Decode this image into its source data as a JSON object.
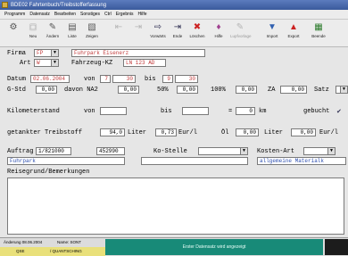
{
  "window": {
    "title": "BDE02  Fahrtenbuch/Treibstofferfassung"
  },
  "menu": [
    "Programm",
    "Datensatz",
    "Bearbeiten",
    "Sonstiges",
    "Ctrl",
    "Ergebnis",
    "Hilfe"
  ],
  "toolbar": [
    {
      "label": "",
      "icon": "record-icon",
      "disabled": false
    },
    {
      "label": "Neu",
      "icon": "new-icon",
      "disabled": false
    },
    {
      "label": "Ändern",
      "icon": "edit-icon",
      "disabled": false
    },
    {
      "label": "Liste",
      "icon": "list-icon",
      "disabled": false
    },
    {
      "label": "Zeigen",
      "icon": "show-icon",
      "disabled": false
    },
    {
      "label": "",
      "icon": "back-icon",
      "disabled": true
    },
    {
      "label": "",
      "icon": "forward-icon",
      "disabled": true
    },
    {
      "label": "Vorwärts",
      "icon": "next-icon",
      "disabled": false
    },
    {
      "label": "Ende",
      "icon": "end-icon",
      "disabled": false
    },
    {
      "label": "Löschen",
      "icon": "delete-icon",
      "disabled": false
    },
    {
      "label": "Hilfe",
      "icon": "help-icon",
      "disabled": false
    },
    {
      "label": "Lupfvorlage",
      "icon": "template-icon",
      "disabled": true
    },
    {
      "label": "Import",
      "icon": "import-icon",
      "disabled": false
    },
    {
      "label": "Export",
      "icon": "export-icon",
      "disabled": false
    },
    {
      "label": "Beende",
      "icon": "exit-icon",
      "disabled": false
    }
  ],
  "form": {
    "firma_label": "Firma",
    "firma_value": "FP",
    "firma_name": "Fuhrpark Eisenerz",
    "art_label": "Art",
    "art_value": "W",
    "kz_label": "Fahrzeug-KZ",
    "kz_value": "LN 123 AD",
    "datum_label": "Datum",
    "datum_value": "02.06.2004",
    "von_label": "von",
    "von_h": "7",
    "von_m": "30",
    "bis_label": "bis",
    "bis_h": "9",
    "bis_m": "30",
    "gstd_label": "G-Std",
    "gstd_value": "0,00",
    "davon_na2_label": "davon NA2",
    "na2_value": "0,00",
    "p50_label": "50%",
    "p50_value": "0,00",
    "p100_label": "100%",
    "p100_value": "0,00",
    "za_label": "ZA",
    "za_value": "0,00",
    "satz_label": "Satz",
    "km_label": "Kilometerstand",
    "km_von_label": "von",
    "km_von_value": "",
    "km_bis_label": "bis",
    "km_bis_value": "",
    "km_eq": "=",
    "km_result": "0",
    "km_unit": "km",
    "gebucht_label": "gebucht",
    "gebucht_mark": "✔",
    "treib_label": "getankter Treibstoff",
    "treib_value": "94,0",
    "liter_label": "Liter",
    "preis_value": "0,73",
    "eurl_label": "Eur/l",
    "oel_label": "Öl",
    "oel_value": "0,00",
    "oel_liter_label": "Liter",
    "oel_preis_value": "0,00",
    "oel_eurl_label": "Eur/l",
    "auftrag_label": "Auftrag",
    "auftrag_value": "1/821000",
    "auftrag2_value": "452990",
    "auftrag_desc": "Fuhrpark",
    "kostelle_label": "Ko-Stelle",
    "kostelle_value": "",
    "kostenart_label": "Kosten-Art",
    "kostenart_value": "",
    "kostenart_desc": "allgemeine Materialk",
    "reise_label": "Reisegrund/Bemerkungen",
    "reise_value": ""
  },
  "status": {
    "aenderung": "Änderung 08.06.2004",
    "name": "Name: SONT",
    "user": "QSE",
    "dept": "/ QUANTSCHING",
    "message": "Erster Datensatz wird angezeigt"
  }
}
